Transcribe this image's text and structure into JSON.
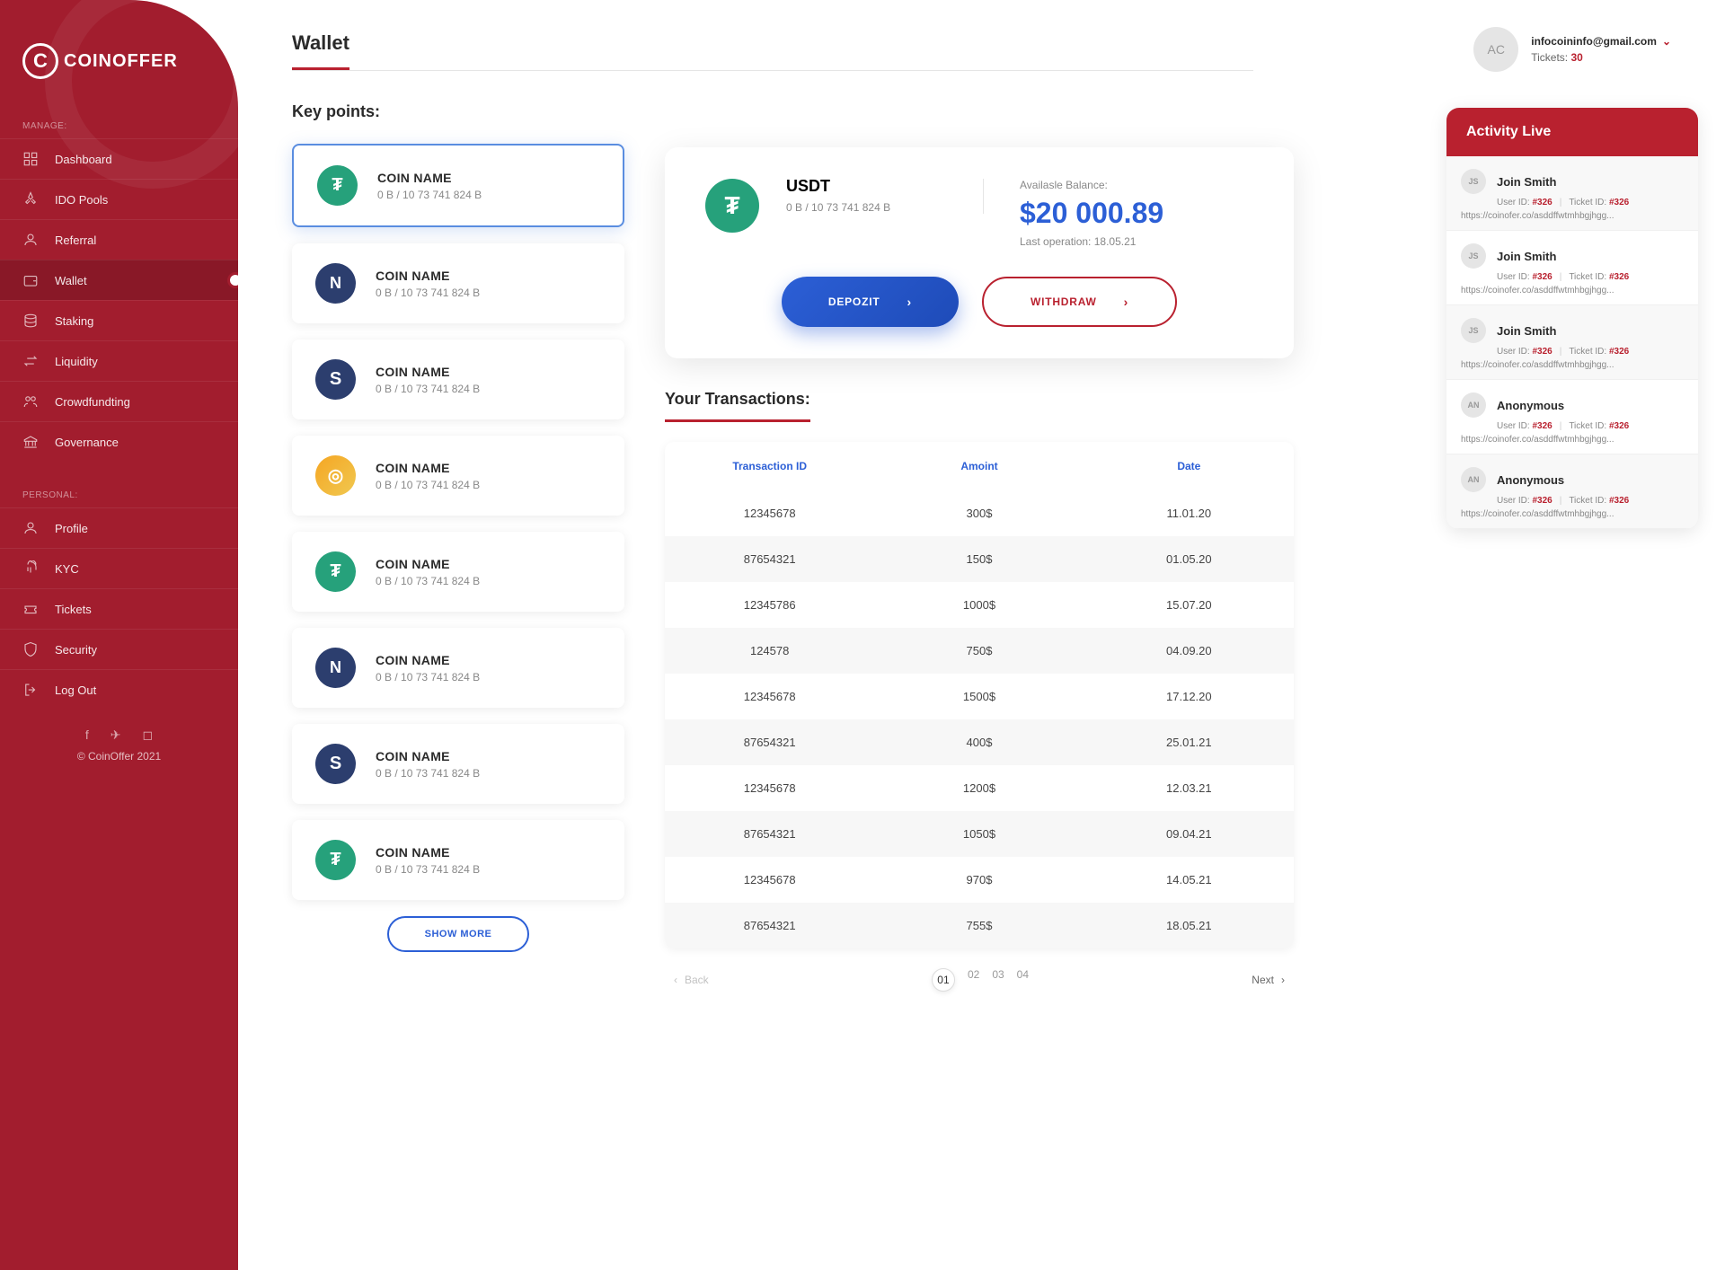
{
  "logo": "COINOFFER",
  "sidebar": {
    "manage_label": "MANAGE:",
    "personal_label": "PERSONAL:",
    "manage": [
      {
        "label": "Dashboard"
      },
      {
        "label": "IDO Pools"
      },
      {
        "label": "Referral"
      },
      {
        "label": "Wallet"
      },
      {
        "label": "Staking"
      },
      {
        "label": "Liquidity"
      },
      {
        "label": "Crowdfundting"
      },
      {
        "label": "Governance"
      }
    ],
    "personal": [
      {
        "label": "Profile"
      },
      {
        "label": "KYC"
      },
      {
        "label": "Tickets"
      },
      {
        "label": "Security"
      },
      {
        "label": "Log Out"
      }
    ],
    "copyright": "© CoinOffer 2021"
  },
  "page_title": "Wallet",
  "user": {
    "initials": "AC",
    "email": "infocoininfo@gmail.com",
    "tickets_label": "Tickets:",
    "tickets_count": "30"
  },
  "key_points_title": "Key points:",
  "coins": [
    {
      "name": "COIN NAME",
      "sub": "0 B / 10 73 741 824 B",
      "icon": "usdt",
      "glyph": "₮"
    },
    {
      "name": "COIN NAME",
      "sub": "0 B / 10 73 741 824 B",
      "icon": "n",
      "glyph": "N"
    },
    {
      "name": "COIN NAME",
      "sub": "0 B / 10 73 741 824 B",
      "icon": "s",
      "glyph": "S"
    },
    {
      "name": "COIN NAME",
      "sub": "0 B / 10 73 741 824 B",
      "icon": "gold",
      "glyph": "◎"
    },
    {
      "name": "COIN NAME",
      "sub": "0 B / 10 73 741 824 B",
      "icon": "usdt",
      "glyph": "₮"
    },
    {
      "name": "COIN NAME",
      "sub": "0 B / 10 73 741 824 B",
      "icon": "n",
      "glyph": "N"
    },
    {
      "name": "COIN NAME",
      "sub": "0 B / 10 73 741 824 B",
      "icon": "s",
      "glyph": "S"
    },
    {
      "name": "COIN NAME",
      "sub": "0 B / 10 73 741 824 B",
      "icon": "usdt",
      "glyph": "₮"
    }
  ],
  "show_more": "SHOW MORE",
  "balance": {
    "coin": "USDT",
    "sub": "0 B / 10 73 741 824 B",
    "available_label": "Availasle Balance:",
    "amount": "$20 000.89",
    "last_op": "Last operation: 18.05.21",
    "deposit": "DEPOZIT",
    "withdraw": "WITHDRAW"
  },
  "tx_title": "Your Transactions:",
  "tx_headers": {
    "id": "Transaction ID",
    "amount": "Amoint",
    "date": "Date"
  },
  "transactions": [
    {
      "id": "12345678",
      "amount": "300$",
      "date": "11.01.20"
    },
    {
      "id": "87654321",
      "amount": "150$",
      "date": "01.05.20"
    },
    {
      "id": "12345786",
      "amount": "1000$",
      "date": "15.07.20"
    },
    {
      "id": "124578",
      "amount": "750$",
      "date": "04.09.20"
    },
    {
      "id": "12345678",
      "amount": "1500$",
      "date": "17.12.20"
    },
    {
      "id": "87654321",
      "amount": "400$",
      "date": "25.01.21"
    },
    {
      "id": "12345678",
      "amount": "1200$",
      "date": "12.03.21"
    },
    {
      "id": "87654321",
      "amount": "1050$",
      "date": "09.04.21"
    },
    {
      "id": "12345678",
      "amount": "970$",
      "date": "14.05.21"
    },
    {
      "id": "87654321",
      "amount": "755$",
      "date": "18.05.21"
    }
  ],
  "pagination": {
    "back": "Back",
    "next": "Next",
    "pages": [
      "01",
      "02",
      "03",
      "04"
    ]
  },
  "activity": {
    "title": "Activity Live",
    "items": [
      {
        "initials": "JS",
        "name": "Join Smith",
        "user_id": "#326",
        "ticket_id": "#326",
        "link": "https://coinofer.co/asddffwtmhbgjhgg..."
      },
      {
        "initials": "JS",
        "name": "Join Smith",
        "user_id": "#326",
        "ticket_id": "#326",
        "link": "https://coinofer.co/asddffwtmhbgjhgg..."
      },
      {
        "initials": "JS",
        "name": "Join Smith",
        "user_id": "#326",
        "ticket_id": "#326",
        "link": "https://coinofer.co/asddffwtmhbgjhgg..."
      },
      {
        "initials": "AN",
        "name": "Anonymous",
        "user_id": "#326",
        "ticket_id": "#326",
        "link": "https://coinofer.co/asddffwtmhbgjhgg..."
      },
      {
        "initials": "AN",
        "name": "Anonymous",
        "user_id": "#326",
        "ticket_id": "#326",
        "link": "https://coinofer.co/asddffwtmhbgjhgg..."
      }
    ],
    "user_id_label": "User ID:",
    "ticket_id_label": "Ticket ID:"
  }
}
